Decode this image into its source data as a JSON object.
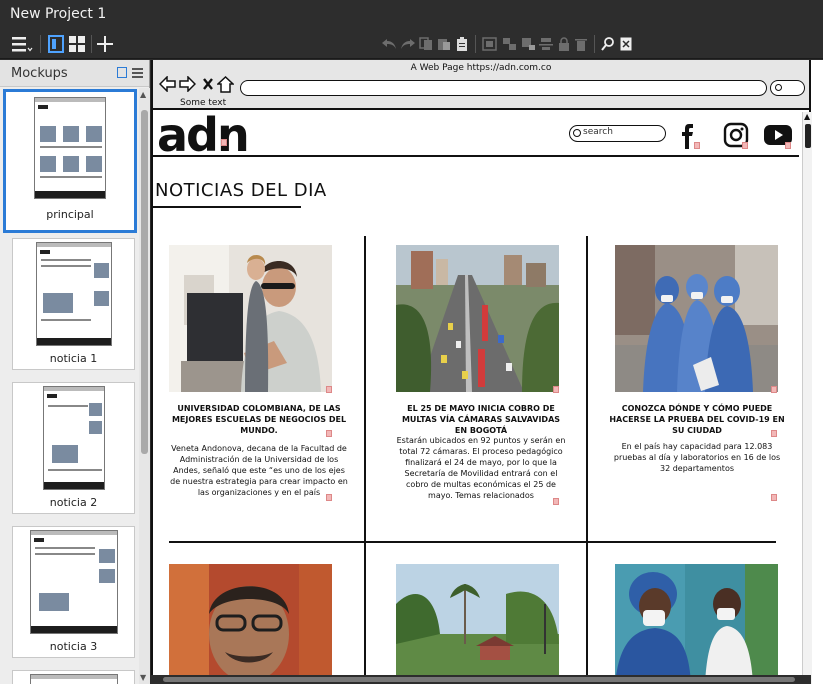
{
  "app": {
    "title": "New Project 1"
  },
  "left_panel": {
    "title": "Mockups",
    "pages": [
      {
        "label": "principal",
        "selected": true
      },
      {
        "label": "noticia 1",
        "selected": false
      },
      {
        "label": "noticia 2",
        "selected": false
      },
      {
        "label": "noticia 3",
        "selected": false
      }
    ]
  },
  "browser": {
    "title": "A Web Page https://adn.com.co",
    "some_text": "Some text",
    "url": ""
  },
  "site": {
    "logo": "adn",
    "search_placeholder": "search",
    "section_title": "NOTICIAS DEL DIA",
    "cards": [
      {
        "title": "UNIVERSIDAD COLOMBIANA, DE LAS MEJORES ESCUELAS DE NEGOCIOS DEL MUNDO.",
        "text": "Veneta Andonova, decana de la Facultad de Administración de la Universidad de los Andes, señaló que este “es uno de los ejes de nuestra estrategia para crear impacto en las organizaciones y en el país"
      },
      {
        "title": "EL 25 DE MAYO INICIA COBRO DE MULTAS VÍA CÁMARAS SALVAVIDAS EN BOGOTÁ",
        "text": "Estarán ubicados en 92 puntos y serán en total 72 cámaras. El proceso pedagógico finalizará el 24 de mayo, por lo que la Secretaría de Movilidad entrará con el cobro de multas económicas el 25 de mayo. Temas relacionados"
      },
      {
        "title": "CONOZCA DÓNDE Y CÓMO PUEDE HACERSE LA PRUEBA DEL COVID-19 EN SU CIUDAD",
        "text": "En el país hay capacidad para 12.083 pruebas al día y laboratorios en 16 de los 32 departamentos"
      }
    ]
  },
  "colors": {
    "accent": "#2b7bd6",
    "chrome_dark": "#2d2d2d"
  }
}
